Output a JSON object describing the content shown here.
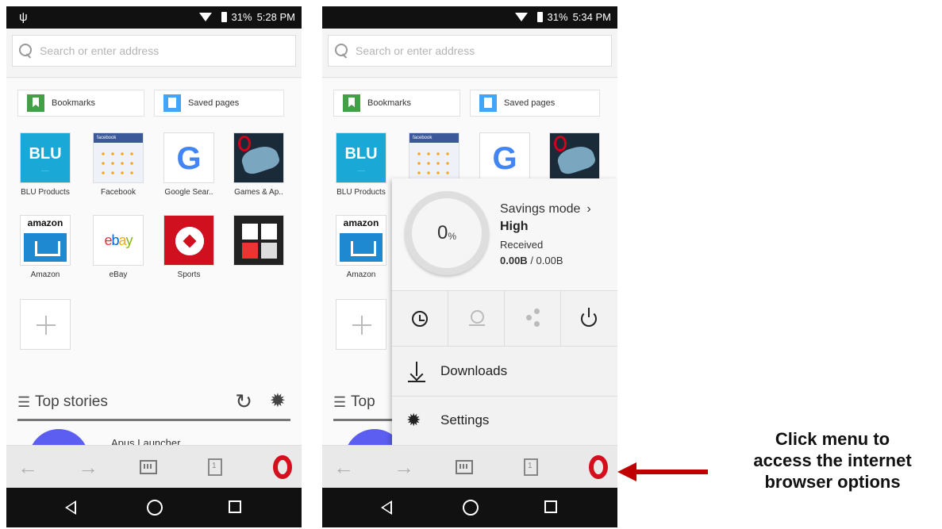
{
  "left_screen": {
    "status": {
      "battery": "31%",
      "time": "5:28 PM"
    },
    "search_placeholder": "Search or enter address",
    "quick": {
      "bookmarks": "Bookmarks",
      "saved_pages": "Saved pages"
    },
    "tiles": [
      "BLU Products",
      "Facebook",
      "Google Sear..",
      "Games & Ap..",
      "Amazon",
      "eBay",
      "Sports"
    ],
    "top_stories": "Top stories",
    "story_title": "Apus Launcher"
  },
  "right_screen": {
    "status": {
      "battery": "31%",
      "time": "5:34 PM"
    },
    "search_placeholder": "Search or enter address",
    "quick": {
      "bookmarks": "Bookmarks",
      "saved_pages": "Saved pages"
    },
    "tiles": [
      "BLU Products",
      "Amazon"
    ],
    "top_stories_partial": "Top",
    "menu": {
      "savings_percent": "0",
      "savings_unit": "%",
      "savings_mode": "Savings mode",
      "savings_level": "High",
      "received_label": "Received",
      "received_amount": "0.00B",
      "received_total": "0.00B",
      "downloads": "Downloads",
      "settings": "Settings"
    }
  },
  "tile_logos": {
    "blu": "BLU",
    "facebook_bar": "facebook",
    "google": "G",
    "amazon": "amazon",
    "ebay": "ebay"
  },
  "callout": {
    "line1": "Click menu to",
    "line2": "access the internet",
    "line3": "browser options",
    "arrow_color": "#c00000"
  },
  "colors": {
    "opera_red": "#d50f1e",
    "bookmarks_green": "#43a047",
    "saved_blue": "#42a5f5"
  }
}
